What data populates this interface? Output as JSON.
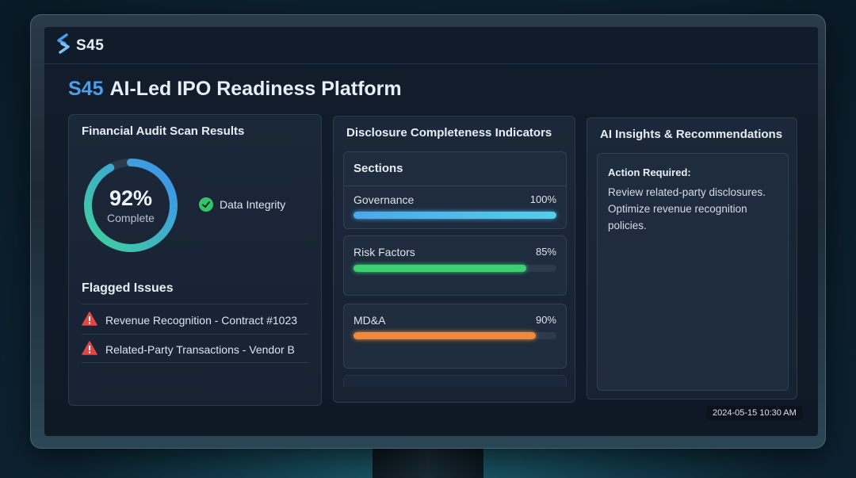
{
  "app": {
    "logo_text": "S45"
  },
  "page": {
    "title_brand": "S45",
    "title_text": "AI-Led IPO Readiness Platform"
  },
  "audit": {
    "title": "Financial Audit Scan Results",
    "progress_pct": 92,
    "progress_label": "92%",
    "progress_sub": "Complete",
    "integrity_label": "Data Integrity",
    "flagged_title": "Flagged Issues",
    "issues": [
      {
        "text": "Revenue Recognition - Contract #1023",
        "icon": "warning-icon"
      },
      {
        "text": "Related-Party Transactions - Vendor B",
        "icon": "warning-icon"
      }
    ]
  },
  "disclosure": {
    "title": "Disclosure Completeness Indicators",
    "sections_label": "Sections",
    "items": [
      {
        "label": "Governance",
        "value": "100%",
        "pct": 100,
        "color": "#4aa8ec"
      },
      {
        "label": "Risk Factors",
        "value": "85%",
        "pct": 85,
        "color": "#3ecf74"
      },
      {
        "label": "MD&A",
        "value": "90%",
        "pct": 90,
        "color": "#f08a3a"
      }
    ]
  },
  "insights": {
    "title": "AI Insights & Recommendations",
    "action_head": "Action Required:",
    "action_text": "Review related-party disclosures. Optimize revenue recognition policies."
  },
  "timestamp": "2024-05-15 10:30 AM",
  "colors": {
    "accent": "#4a9eea",
    "success": "#35c36a",
    "warning": "#e04848"
  }
}
